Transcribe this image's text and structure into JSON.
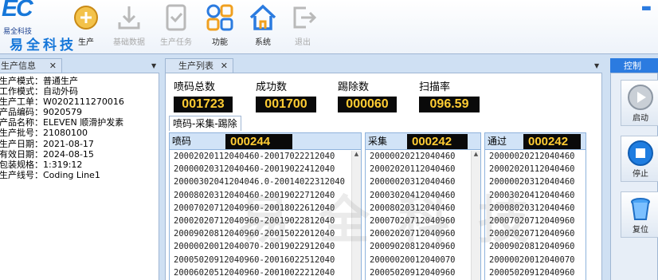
{
  "logo": {
    "mark": "EC",
    "company_small": "易全科技",
    "company_big": "易全科技"
  },
  "toolbar": [
    {
      "label": "生产",
      "icon": "production-icon",
      "enabled": true
    },
    {
      "label": "基础数据",
      "icon": "download-icon",
      "enabled": false
    },
    {
      "label": "生产任务",
      "icon": "task-icon",
      "enabled": false
    },
    {
      "label": "功能",
      "icon": "grid-icon",
      "enabled": true
    },
    {
      "label": "系统",
      "icon": "home-icon",
      "enabled": true
    },
    {
      "label": "退出",
      "icon": "exit-icon",
      "enabled": false
    }
  ],
  "panels": {
    "info_title": "生产信息",
    "list_title": "生产列表",
    "control_title": "控制"
  },
  "info_rows": [
    "生产模式：普通生产",
    "工作模式：自动外码",
    "生产工单：W0202111270016",
    "产品编码：9020579",
    "产品名称：ELEVEN 顺滑护发素",
    "生产批号：21080100",
    "生产日期：2021-08-17",
    "有效日期：2024-08-15",
    "包装规格：1:319:12",
    "生产线号：Coding Line1"
  ],
  "stats": {
    "total": {
      "label": "喷码总数",
      "value": "001723"
    },
    "success": {
      "label": "成功数",
      "value": "001700"
    },
    "reject": {
      "label": "踢除数",
      "value": "000060"
    },
    "scan_rate": {
      "label": "扫描率",
      "value": "096.59"
    }
  },
  "subtab": "喷码-采集-踢除",
  "lists": {
    "code": {
      "title": "喷码",
      "count": "000244",
      "items": [
        "20002020112040460-20017022212040",
        "20000020312040460-20019022412040",
        "20000302041204046.0-20014022312040",
        "20008020312040460-20019022712040",
        "20007020712040960-20018022612040",
        "20002020712040960-20019022812040",
        "20009020812040960-20015022012040",
        "20000020012040070-20019022912040",
        "20005020912040960-20016022512040",
        "20006020512040960-20010022212040"
      ]
    },
    "collect": {
      "title": "采集",
      "count": "000242",
      "items": [
        "20000020212040460",
        "20002020112040460",
        "20000020312040460",
        "20003020412040460",
        "20008020312040460",
        "20007020712040960",
        "20002020712040960",
        "20009020812040960",
        "20000020012040070",
        "20005020912040960"
      ]
    },
    "pass": {
      "title": "通过",
      "count": "000242",
      "items": [
        "20000020212040460",
        "20002020112040460",
        "20000020312040460",
        "20003020412040460",
        "20008020312040460",
        "20007020712040960",
        "20002020712040960",
        "20009020812040960",
        "20000020012040070",
        "20005020912040960"
      ]
    }
  },
  "controls": {
    "start": "启动",
    "stop": "停止",
    "reset": "复位"
  },
  "watermark": "易全科技",
  "colors": {
    "counter_bg": "#0a0a0a",
    "counter_fg": "#ffcc33",
    "accent": "#1677d9"
  }
}
